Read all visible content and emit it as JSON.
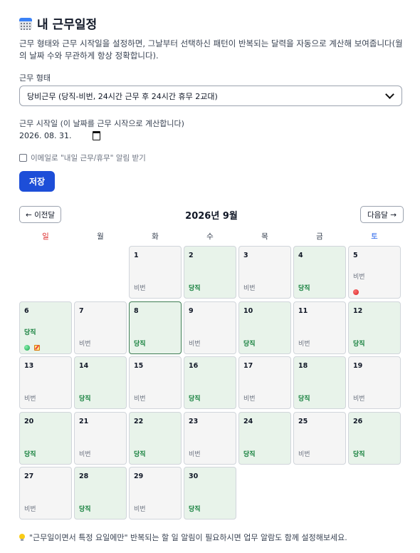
{
  "title": "내 근무일정",
  "description": "근무 형태와 근무 시작일을 설정하면, 그날부터 선택하신 패턴이 반복되는 달력을 자동으로 계산해 보여줍니다(월의 날짜 수와 무관하게 항상 정확합니다).",
  "work_type": {
    "label": "근무 형태",
    "selected": "당비근무 (당직-비번, 24시간 근무 후 24시간 휴무 2교대)"
  },
  "start_date": {
    "label": "근무 시작일 (이 날짜를 근무 시작으로 계산합니다)",
    "value": "2026. 08. 31."
  },
  "email_alert": {
    "label": "이메일로 \"내일 근무/휴무\" 알림 받기",
    "checked": false
  },
  "save_label": "저장",
  "calendar": {
    "prev_label": "← 이전달",
    "next_label": "다음달 →",
    "month_title": "2026년 9월",
    "weekdays": [
      "일",
      "월",
      "화",
      "수",
      "목",
      "금",
      "토"
    ],
    "days": [
      {
        "day": "1",
        "shift": "비번",
        "duty": false
      },
      {
        "day": "2",
        "shift": "당직",
        "duty": true
      },
      {
        "day": "3",
        "shift": "비번",
        "duty": false
      },
      {
        "day": "4",
        "shift": "당직",
        "duty": true
      },
      {
        "day": "5",
        "shift": "비번",
        "duty": false
      },
      {
        "day": "6",
        "shift": "당직",
        "duty": true
      },
      {
        "day": "7",
        "shift": "비번",
        "duty": false
      },
      {
        "day": "8",
        "shift": "당직",
        "duty": true
      },
      {
        "day": "9",
        "shift": "비번",
        "duty": false
      },
      {
        "day": "10",
        "shift": "당직",
        "duty": true
      },
      {
        "day": "11",
        "shift": "비번",
        "duty": false
      },
      {
        "day": "12",
        "shift": "당직",
        "duty": true
      },
      {
        "day": "13",
        "shift": "비번",
        "duty": false
      },
      {
        "day": "14",
        "shift": "당직",
        "duty": true
      },
      {
        "day": "15",
        "shift": "비번",
        "duty": false
      },
      {
        "day": "16",
        "shift": "당직",
        "duty": true
      },
      {
        "day": "17",
        "shift": "비번",
        "duty": false
      },
      {
        "day": "18",
        "shift": "당직",
        "duty": true
      },
      {
        "day": "19",
        "shift": "비번",
        "duty": false
      },
      {
        "day": "20",
        "shift": "당직",
        "duty": true
      },
      {
        "day": "21",
        "shift": "비번",
        "duty": false
      },
      {
        "day": "22",
        "shift": "당직",
        "duty": true
      },
      {
        "day": "23",
        "shift": "비번",
        "duty": false
      },
      {
        "day": "24",
        "shift": "당직",
        "duty": true
      },
      {
        "day": "25",
        "shift": "비번",
        "duty": false
      },
      {
        "day": "26",
        "shift": "당직",
        "duty": true
      },
      {
        "day": "27",
        "shift": "비번",
        "duty": false
      },
      {
        "day": "28",
        "shift": "당직",
        "duty": true
      },
      {
        "day": "29",
        "shift": "비번",
        "duty": false
      },
      {
        "day": "30",
        "shift": "당직",
        "duty": true
      }
    ]
  },
  "footer_tip": "\"근무일이면서 특정 요일에만\" 반복되는 할 일 알림이 필요하시면 업무 알람도 함께 설정해보세요."
}
